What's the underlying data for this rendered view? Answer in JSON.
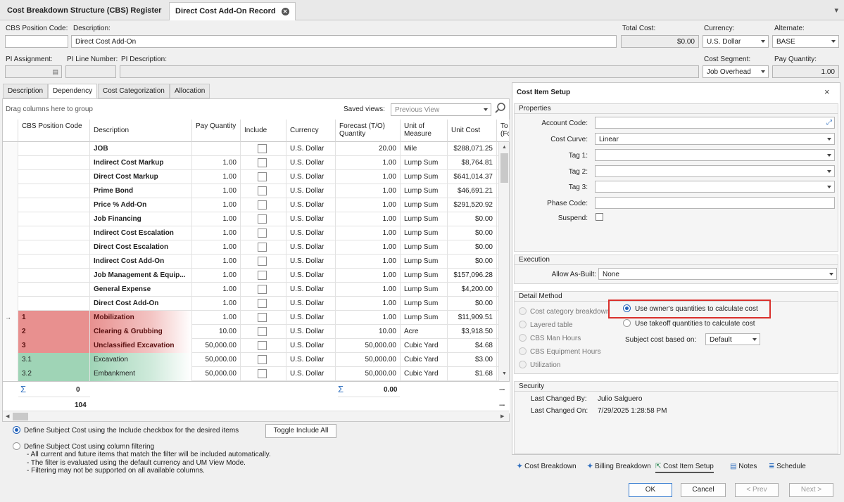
{
  "tabs": [
    {
      "label": "Cost Breakdown Structure (CBS) Register"
    },
    {
      "label": "Direct Cost Add-On Record"
    }
  ],
  "header": {
    "cbs_position_code": {
      "label": "CBS Position Code:",
      "value": ""
    },
    "description": {
      "label": "Description:",
      "value": "Direct Cost Add-On"
    },
    "total_cost": {
      "label": "Total Cost:",
      "value": "$0.00"
    },
    "currency": {
      "label": "Currency:",
      "value": "U.S. Dollar"
    },
    "alternate": {
      "label": "Alternate:",
      "value": "BASE"
    },
    "pi_assignment": {
      "label": "PI Assignment:",
      "value": ""
    },
    "pi_line_number": {
      "label": "PI Line Number:",
      "value": ""
    },
    "pi_description": {
      "label": "PI Description:",
      "value": ""
    },
    "cost_segment": {
      "label": "Cost Segment:",
      "value": "Job Overhead"
    },
    "pay_quantity": {
      "label": "Pay Quantity:",
      "value": "1.00"
    }
  },
  "sub_tabs": [
    {
      "label": "Description"
    },
    {
      "label": "Dependency"
    },
    {
      "label": "Cost Categorization"
    },
    {
      "label": "Allocation"
    }
  ],
  "grid": {
    "group_hint": "Drag columns here to group",
    "saved_views_label": "Saved views:",
    "saved_views_placeholder": "Previous View",
    "columns": [
      "CBS Position Code",
      "Description",
      "Pay Quantity",
      "Include",
      "Currency",
      "Forecast (T/O) Quantity",
      "Unit of Measure",
      "Unit Cost",
      "To (Fo"
    ],
    "rows": [
      {
        "code": "",
        "desc": "JOB",
        "pay": "",
        "currency": "U.S. Dollar",
        "forecast": "20.00",
        "uom": "Mile",
        "unit_cost": "$288,071.25"
      },
      {
        "code": "",
        "desc": "Indirect Cost Markup",
        "pay": "1.00",
        "currency": "U.S. Dollar",
        "forecast": "1.00",
        "uom": "Lump Sum",
        "unit_cost": "$8,764.81"
      },
      {
        "code": "",
        "desc": "Direct Cost Markup",
        "pay": "1.00",
        "currency": "U.S. Dollar",
        "forecast": "1.00",
        "uom": "Lump Sum",
        "unit_cost": "$641,014.37"
      },
      {
        "code": "",
        "desc": "Prime Bond",
        "pay": "1.00",
        "currency": "U.S. Dollar",
        "forecast": "1.00",
        "uom": "Lump Sum",
        "unit_cost": "$46,691.21"
      },
      {
        "code": "",
        "desc": "Price % Add-On",
        "pay": "1.00",
        "currency": "U.S. Dollar",
        "forecast": "1.00",
        "uom": "Lump Sum",
        "unit_cost": "$291,520.92"
      },
      {
        "code": "",
        "desc": "Job Financing",
        "pay": "1.00",
        "currency": "U.S. Dollar",
        "forecast": "1.00",
        "uom": "Lump Sum",
        "unit_cost": "$0.00"
      },
      {
        "code": "",
        "desc": "Indirect Cost Escalation",
        "pay": "1.00",
        "currency": "U.S. Dollar",
        "forecast": "1.00",
        "uom": "Lump Sum",
        "unit_cost": "$0.00"
      },
      {
        "code": "",
        "desc": "Direct Cost Escalation",
        "pay": "1.00",
        "currency": "U.S. Dollar",
        "forecast": "1.00",
        "uom": "Lump Sum",
        "unit_cost": "$0.00"
      },
      {
        "code": "",
        "desc": "Indirect Cost Add-On",
        "pay": "1.00",
        "currency": "U.S. Dollar",
        "forecast": "1.00",
        "uom": "Lump Sum",
        "unit_cost": "$0.00"
      },
      {
        "code": "",
        "desc": "Job Management & Equip...",
        "pay": "1.00",
        "currency": "U.S. Dollar",
        "forecast": "1.00",
        "uom": "Lump Sum",
        "unit_cost": "$157,096.28"
      },
      {
        "code": "",
        "desc": "General Expense",
        "pay": "1.00",
        "currency": "U.S. Dollar",
        "forecast": "1.00",
        "uom": "Lump Sum",
        "unit_cost": "$4,200.00"
      },
      {
        "code": "",
        "desc": "Direct Cost Add-On",
        "pay": "1.00",
        "currency": "U.S. Dollar",
        "forecast": "1.00",
        "uom": "Lump Sum",
        "unit_cost": "$0.00"
      },
      {
        "code": "1",
        "desc": "Mobilization",
        "pay": "1.00",
        "currency": "U.S. Dollar",
        "forecast": "1.00",
        "uom": "Lump Sum",
        "unit_cost": "$11,909.51"
      },
      {
        "code": "2",
        "desc": "Clearing & Grubbing",
        "pay": "10.00",
        "currency": "U.S. Dollar",
        "forecast": "10.00",
        "uom": "Acre",
        "unit_cost": "$3,918.50"
      },
      {
        "code": "3",
        "desc": "Unclassified Excavation",
        "pay": "50,000.00",
        "currency": "U.S. Dollar",
        "forecast": "50,000.00",
        "uom": "Cubic Yard",
        "unit_cost": "$4.68"
      },
      {
        "code": "3.1",
        "desc": "Excavation",
        "pay": "50,000.00",
        "currency": "U.S. Dollar",
        "forecast": "50,000.00",
        "uom": "Cubic Yard",
        "unit_cost": "$3.00"
      },
      {
        "code": "3.2",
        "desc": "Embankment",
        "pay": "50,000.00",
        "currency": "U.S. Dollar",
        "forecast": "50,000.00",
        "uom": "Cubic Yard",
        "unit_cost": "$1.68"
      }
    ],
    "summary_sum_code": "0",
    "summary_count": "104",
    "summary_sum_forecast": "0.00",
    "ellipsis": "..."
  },
  "subject_cost": {
    "option1": "Define Subject Cost using the Include checkbox for the desired items",
    "option2": "Define Subject Cost using column filtering",
    "note1": "- All current and future items that match the filter will be included automatically.",
    "note2": "- The filter is evaluated using the default currency and UM View Mode.",
    "note3": "- Filtering may not be supported on all available columns.",
    "toggle_label": "Toggle Include All"
  },
  "setup": {
    "title": "Cost Item Setup",
    "properties_title": "Properties",
    "account_code_label": "Account Code:",
    "cost_curve_label": "Cost Curve:",
    "cost_curve_value": "Linear",
    "tag1_label": "Tag 1:",
    "tag2_label": "Tag 2:",
    "tag3_label": "Tag 3:",
    "phase_code_label": "Phase Code:",
    "suspend_label": "Suspend:",
    "execution_title": "Execution",
    "allow_as_built_label": "Allow As-Built:",
    "allow_as_built_value": "None",
    "detail_method_title": "Detail Method",
    "methods": [
      "Cost category breakdown",
      "Layered table",
      "CBS Man Hours",
      "CBS Equipment Hours",
      "Utilization"
    ],
    "use_owner": "Use owner's quantities to calculate cost",
    "use_takeoff": "Use takeoff quantities to calculate cost",
    "subject_cost_based_label": "Subject cost based on:",
    "subject_cost_based_value": "Default",
    "security_title": "Security",
    "last_changed_by_label": "Last Changed By:",
    "last_changed_by_value": "Julio Salguero",
    "last_changed_on_label": "Last Changed On:",
    "last_changed_on_value": "7/29/2025 1:28:58 PM",
    "highlight_color": "#d9302c"
  },
  "footer_tabs": [
    {
      "label": "Cost Breakdown"
    },
    {
      "label": "Billing Breakdown"
    },
    {
      "label": "Cost Item Setup"
    },
    {
      "label": "Notes"
    },
    {
      "label": "Schedule"
    }
  ],
  "buttons": {
    "ok": "OK",
    "cancel": "Cancel",
    "prev": "< Prev",
    "next": "Next >"
  }
}
